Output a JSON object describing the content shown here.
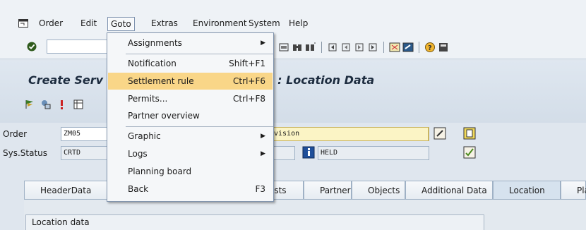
{
  "menubar": {
    "items": [
      "Order",
      "Edit",
      "Goto",
      "Extras",
      "Environment",
      "System",
      "Help"
    ]
  },
  "title": "Create Serv",
  "title_tail": "l price/SLA) : Location Data",
  "fields": {
    "order_label": "Order",
    "order_value": "ZM05",
    "order_desc": "vision",
    "status_label": "Sys.Status",
    "status_value": "CRTD",
    "status_user": "HELD"
  },
  "tabs": [
    "HeaderData",
    "osts",
    "Partner",
    "Objects",
    "Additional Data",
    "Location",
    "Pla"
  ],
  "active_tab": "Location",
  "group_title": "Location data",
  "dropdown": {
    "items": [
      {
        "label": "Assignments",
        "shortcut": "",
        "submenu": true
      },
      {
        "label": "Notification",
        "shortcut": "Shift+F1",
        "submenu": false
      },
      {
        "label": "Settlement rule",
        "shortcut": "Ctrl+F6",
        "submenu": false,
        "highlighted": true
      },
      {
        "label": "Permits...",
        "shortcut": "Ctrl+F8",
        "submenu": false
      },
      {
        "label": "Partner overview",
        "shortcut": "",
        "submenu": false
      },
      {
        "label": "Graphic",
        "shortcut": "",
        "submenu": true
      },
      {
        "label": "Logs",
        "shortcut": "",
        "submenu": true
      },
      {
        "label": "Planning board",
        "shortcut": "",
        "submenu": false
      },
      {
        "label": "Back",
        "shortcut": "F3",
        "submenu": false
      }
    ]
  },
  "colors": {
    "highlight": "#f9d688",
    "title": "#1d2c3f",
    "desc_field": "#fbf4c5"
  }
}
